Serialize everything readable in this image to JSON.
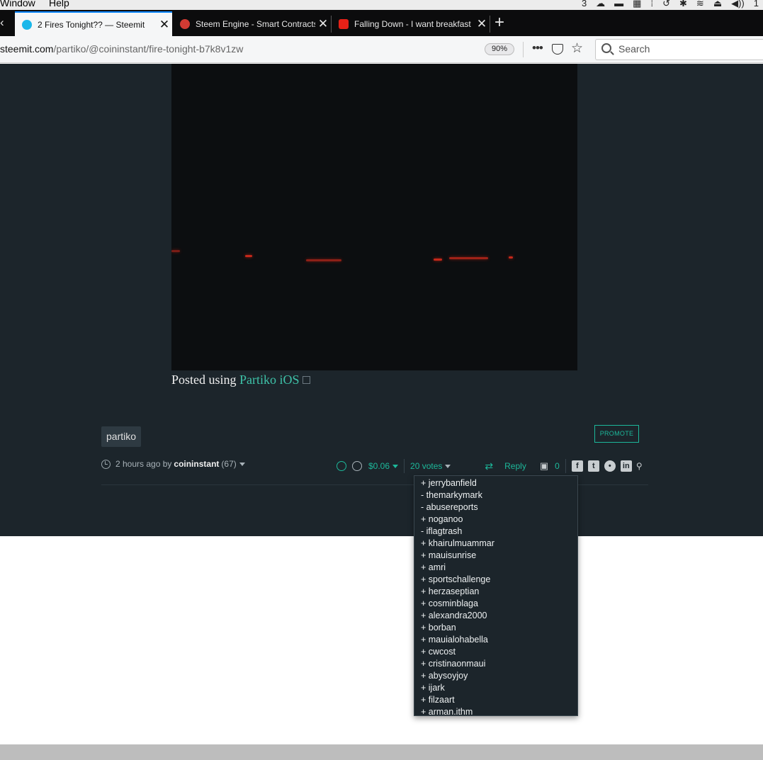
{
  "menubar": {
    "items": [
      "Window",
      "Help"
    ],
    "tray": [
      "3",
      "☁",
      "▬",
      "▦",
      "⁞",
      "↺",
      "✱",
      "≋",
      "⏏",
      "◀))",
      "1"
    ]
  },
  "tabs": [
    {
      "title": "2 Fires Tonight?? — Steemit",
      "favicon": "steemit-icon",
      "favcolor": "#1ab7ea",
      "active": true
    },
    {
      "title": "Steem Engine - Smart Contracts",
      "favicon": "steem-engine-icon",
      "favcolor": "#d23b33",
      "active": false
    },
    {
      "title": "Falling Down - I want breakfast",
      "favicon": "youtube-icon",
      "favcolor": "#e62117",
      "active": false
    }
  ],
  "navbar": {
    "url_host": "steemit.com",
    "url_path": "/partiko/@coininstant/fire-tonight-b7k8v1zw",
    "zoom": "90%",
    "search_placeholder": "Search"
  },
  "post": {
    "posted_prefix": "Posted using",
    "posted_app": "Partiko iOS",
    "tag": "partiko",
    "promote": "PROMOTE",
    "time": "2 hours ago by",
    "author": "coininstant",
    "reputation": "(67)",
    "payout": "$0.06",
    "votes_label": "20 votes",
    "reply": "Reply",
    "comments": "0"
  },
  "voters": [
    "+ jerrybanfield",
    "- themarkymark",
    "- abusereports",
    "+ noganoo",
    "- iflagtrash",
    "+ khairulmuammar",
    "+ mauisunrise",
    "+ amri",
    "+ sportschallenge",
    "+ herzaseptian",
    "+ cosminblaga",
    "+ alexandra2000",
    "+ borban",
    "+ mauialohabella",
    "+ cwcost",
    "+ cristinaonmaui",
    "+ abysoyjoy",
    "+ ijark",
    "+ filzaart",
    "+ arman.ithm"
  ]
}
